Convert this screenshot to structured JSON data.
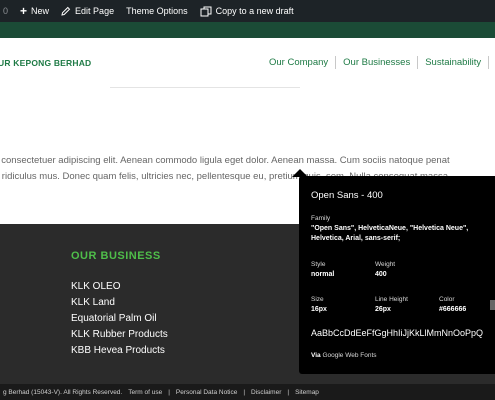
{
  "adminbar": {
    "count": "0",
    "new_label": "New",
    "edit_label": "Edit Page",
    "theme_label": "Theme Options",
    "copy_label": "Copy to a new draft"
  },
  "header": {
    "logo_text": "UR KEPONG BERHAD",
    "nav": [
      {
        "label": "Our Company"
      },
      {
        "label": "Our Businesses"
      },
      {
        "label": "Sustainability"
      }
    ]
  },
  "body": {
    "line1": ", consectetuer adipiscing elit. Aenean commodo ligula eget dolor. Aenean massa. Cum sociis natoque penat",
    "line2": "r ridiculus mus. Donec quam felis, ultricies nec, pellentesque eu, pretium quis, sem. Nulla consequat massa"
  },
  "footer": {
    "title": "OUR BUSINESS",
    "items": [
      "KLK OLEO",
      "KLK Land",
      "Equatorial Palm Oil",
      "KLK Rubber Products",
      "KBB Hevea Products"
    ]
  },
  "bottom_bar": {
    "copyright": "g Berhad (15043-V). All Rights Reserved.",
    "links": [
      "Term of use",
      "Personal Data Notice",
      "Disclaimer",
      "Sitemap"
    ],
    "separator": "|"
  },
  "inspector": {
    "heading": "Open Sans - 400",
    "family_label": "Family",
    "family_value_1": "\"Open Sans\", HelveticaNeue, \"Helvetica Neue\",",
    "family_value_2": "Helvetica, Arial, sans-serif;",
    "style_label": "Style",
    "style_value": "normal",
    "weight_label": "Weight",
    "weight_value": "400",
    "size_label": "Size",
    "size_value": "16px",
    "line_height_label": "Line Height",
    "line_height_value": "26px",
    "color_label": "Color",
    "color_value": "#666666",
    "sample": "AaBbCcDdEeFfGgHhIiJjKkLlMmNnOoPpQ",
    "via_prefix": "Via",
    "via_source": "Google Web Fonts"
  },
  "colors": {
    "brand_green": "#1e7a45",
    "footer_accent": "#4fbe4a",
    "admin_bar": "#1d2327",
    "text_color_sample": "#666666"
  }
}
